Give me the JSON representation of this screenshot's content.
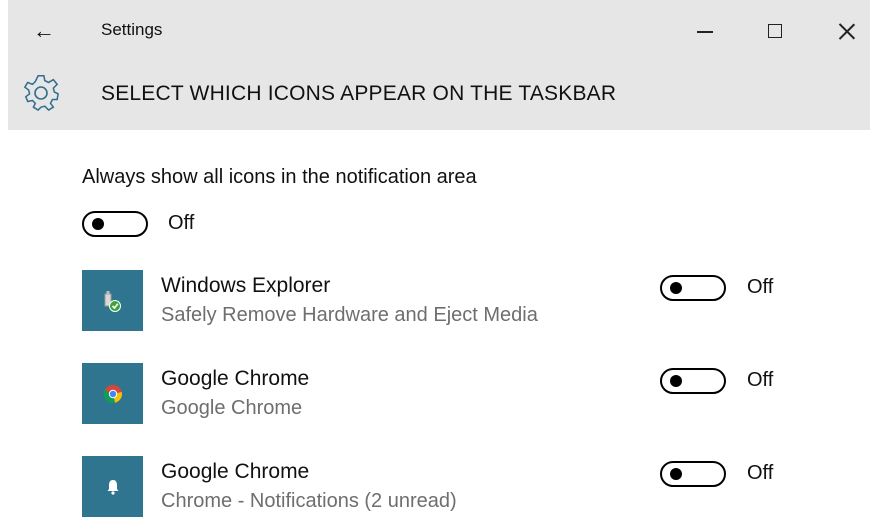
{
  "window": {
    "back_glyph": "←",
    "title": "Settings",
    "controls": [
      "minimize",
      "maximize",
      "close"
    ]
  },
  "header": {
    "icon": "gear-icon",
    "title": "SELECT WHICH ICONS APPEAR ON THE TASKBAR"
  },
  "always_show": {
    "label": "Always show all icons in the notification area",
    "state": "Off"
  },
  "apps": [
    {
      "name": "Windows Explorer",
      "description": "Safely Remove Hardware and Eject Media",
      "icon": "usb-eject-icon",
      "state": "Off"
    },
    {
      "name": "Google Chrome",
      "description": "Google Chrome",
      "icon": "chrome-icon",
      "state": "Off"
    },
    {
      "name": "Google Chrome",
      "description": "Chrome - Notifications (2 unread)",
      "icon": "bell-icon",
      "state": "Off"
    }
  ],
  "colors": {
    "titlebar": "#e6e6e6",
    "tile": "#2f7590",
    "secondary_text": "#6e6e6e"
  }
}
